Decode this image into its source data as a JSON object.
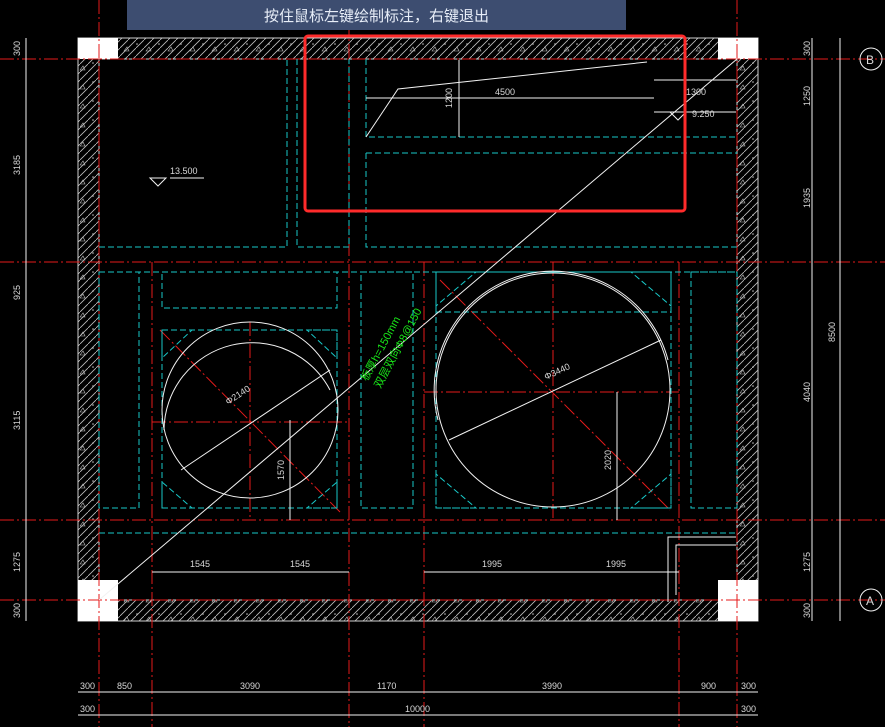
{
  "status_bar": {
    "hint": "按住鼠标左键绘制标注，右键退出"
  },
  "axes": {
    "top": "B",
    "bottom": "A"
  },
  "dims": {
    "left": [
      "300",
      "3185",
      "925",
      "3115",
      "1275",
      "300"
    ],
    "right_segments": [
      "300",
      "1250",
      "1935",
      "4040",
      "1275",
      "300"
    ],
    "right_total": "8500",
    "bottom_row1": [
      "300",
      "850",
      "3090",
      "1170",
      "3990",
      "900",
      "300"
    ],
    "bottom_total": "10000",
    "bottom_left": "300",
    "bottom_right": "300",
    "inner_left": [
      "1545",
      "1545"
    ],
    "inner_right": [
      "1995",
      "1995"
    ],
    "top_slope_len": "4500",
    "top_slope_rise": "1200",
    "top_small": "1300",
    "small_circle_v": "1570",
    "large_circle_v": "2020",
    "small_circle_d": "Φ2140",
    "large_circle_d": "Φ3440"
  },
  "elevations": {
    "left": "13.500",
    "right": "9.250"
  },
  "annotation": {
    "line1": "板厚h=150mm",
    "line2": "双层双向Φ8@150"
  },
  "colors": {
    "red": "#e51a1a",
    "cyan": "#18c8c8",
    "green": "#19e619",
    "white": "#f2f2f2",
    "wall": "#bfbfbf",
    "highlight": "#ff2b2b"
  }
}
